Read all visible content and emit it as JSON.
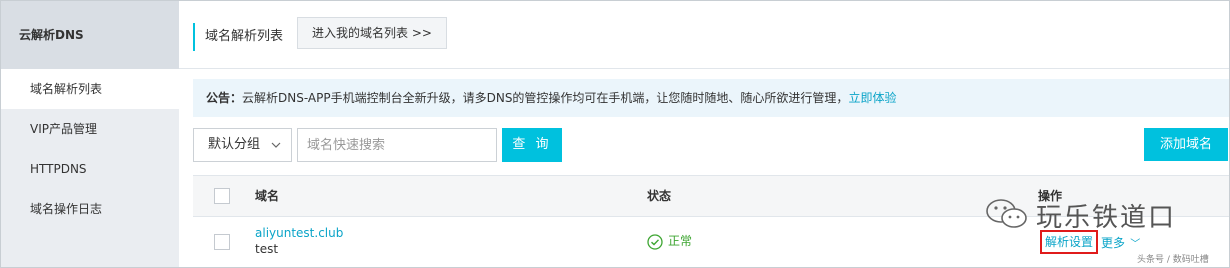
{
  "sidebar": {
    "title": "云解析DNS",
    "items": [
      {
        "label": "域名解析列表",
        "active": true
      },
      {
        "label": "VIP产品管理",
        "active": false
      },
      {
        "label": "HTTPDNS",
        "active": false
      },
      {
        "label": "域名操作日志",
        "active": false
      }
    ]
  },
  "header": {
    "title": "域名解析列表",
    "goto_button": "进入我的域名列表 >>"
  },
  "notice": {
    "prefix": "公告：",
    "text": "云解析DNS-APP手机端控制台全新升级，请多DNS的管控操作均可在手机端，让您随时随地、随心所欲进行管理，",
    "link": "立即体验"
  },
  "toolbar": {
    "group_select": "默认分组",
    "search_placeholder": "域名快速搜索",
    "query_button": "查 询",
    "add_button": "添加域名"
  },
  "table": {
    "columns": [
      "域名",
      "状态",
      "操作"
    ],
    "rows": [
      {
        "domain": "aliyuntest.club",
        "remark": "test",
        "status": "正常",
        "settings": "解析设置",
        "more": "更多"
      }
    ]
  },
  "watermark": {
    "text": "玩乐铁道口",
    "footer": "头条号 / 数码吐槽"
  },
  "colors": {
    "accent": "#00c1de",
    "link": "#0aa4c8",
    "success": "#3da531",
    "highlight": "#e01b1b"
  }
}
